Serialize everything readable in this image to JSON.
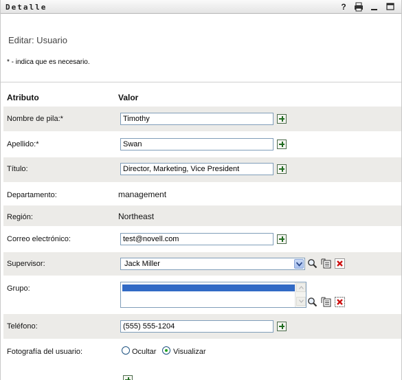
{
  "titlebar": {
    "title": "Detalle",
    "help_icon": "question-mark-icon",
    "print_icon": "print-icon",
    "minimize_icon": "minimize-icon",
    "maximize_icon": "maximize-icon"
  },
  "header": {
    "title": "Editar: Usuario",
    "required_note": "* - indica que es necesario."
  },
  "columns": {
    "attribute": "Atributo",
    "value": "Valor"
  },
  "fields": {
    "first_name": {
      "label": "Nombre de pila:*",
      "value": "Timothy"
    },
    "last_name": {
      "label": "Apellido:*",
      "value": "Swan"
    },
    "title": {
      "label": "Título:",
      "value": "Director, Marketing, Vice President"
    },
    "department": {
      "label": "Departamento:",
      "value": "management"
    },
    "region": {
      "label": "Región:",
      "value": "Northeast"
    },
    "email": {
      "label": "Correo electrónico:",
      "value": "test@novell.com"
    },
    "supervisor": {
      "label": "Supervisor:",
      "value": "Jack Miller"
    },
    "group": {
      "label": "Grupo:",
      "value": ""
    },
    "phone": {
      "label": "Teléfono:",
      "value": "(555) 555-1204"
    },
    "photo": {
      "label": "Fotografía del usuario:",
      "options": [
        "Ocultar",
        "Visualizar"
      ],
      "selected": "Visualizar"
    }
  },
  "colors": {
    "row_shade": "#ecebe8",
    "selection": "#316ac5",
    "add_green": "#1f6b1f",
    "delete_red": "#cc1111"
  }
}
